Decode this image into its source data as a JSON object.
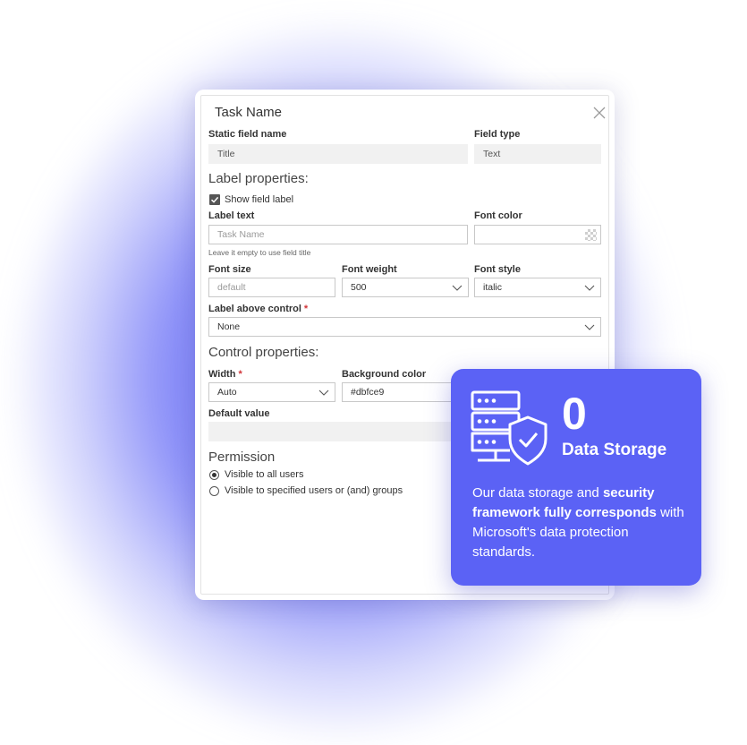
{
  "dialog": {
    "title": "Task Name",
    "static_field_name_label": "Static field name",
    "static_field_name_value": "Title",
    "field_type_label": "Field type",
    "field_type_value": "Text",
    "label_properties_heading": "Label properties:",
    "show_field_label": "Show field label",
    "show_field_label_checked": true,
    "label_text_label": "Label text",
    "label_text_placeholder": "Task Name",
    "label_text_hint": "Leave it empty to use field title",
    "font_color_label": "Font color",
    "font_size_label": "Font size",
    "font_size_placeholder": "default",
    "font_weight_label": "Font weight",
    "font_weight_value": "500",
    "font_style_label": "Font style",
    "font_style_value": "italic",
    "label_above_control_label": "Label above control",
    "label_above_control_value": "None",
    "control_properties_heading": "Control properties:",
    "width_label": "Width",
    "width_value": "Auto",
    "background_color_label": "Background color",
    "background_color_value": "#dbfce9",
    "default_value_label": "Default value",
    "permission_heading": "Permission",
    "permission_options": [
      {
        "label": "Visible to all users",
        "selected": true
      },
      {
        "label": "Visible to specified users or (and) groups",
        "selected": false
      }
    ],
    "required_mark": "*"
  },
  "card": {
    "number": "0",
    "title": "Data Storage",
    "desc_part1": "Our data storage and ",
    "desc_bold": "security framework fully corresponds",
    "desc_part2": " with Microsoft's data protection standards.",
    "icon": "server-shield-icon",
    "accent": "#5b62f5"
  }
}
